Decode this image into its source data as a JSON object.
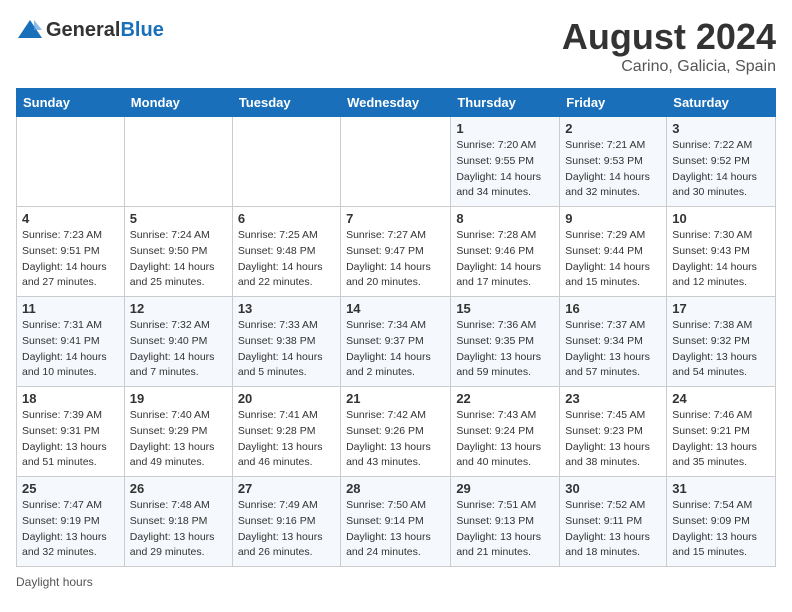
{
  "header": {
    "logo_general": "General",
    "logo_blue": "Blue",
    "month": "August 2024",
    "location": "Carino, Galicia, Spain"
  },
  "days_of_week": [
    "Sunday",
    "Monday",
    "Tuesday",
    "Wednesday",
    "Thursday",
    "Friday",
    "Saturday"
  ],
  "weeks": [
    [
      {
        "day": "",
        "info": ""
      },
      {
        "day": "",
        "info": ""
      },
      {
        "day": "",
        "info": ""
      },
      {
        "day": "",
        "info": ""
      },
      {
        "day": "1",
        "info": "Sunrise: 7:20 AM\nSunset: 9:55 PM\nDaylight: 14 hours\nand 34 minutes."
      },
      {
        "day": "2",
        "info": "Sunrise: 7:21 AM\nSunset: 9:53 PM\nDaylight: 14 hours\nand 32 minutes."
      },
      {
        "day": "3",
        "info": "Sunrise: 7:22 AM\nSunset: 9:52 PM\nDaylight: 14 hours\nand 30 minutes."
      }
    ],
    [
      {
        "day": "4",
        "info": "Sunrise: 7:23 AM\nSunset: 9:51 PM\nDaylight: 14 hours\nand 27 minutes."
      },
      {
        "day": "5",
        "info": "Sunrise: 7:24 AM\nSunset: 9:50 PM\nDaylight: 14 hours\nand 25 minutes."
      },
      {
        "day": "6",
        "info": "Sunrise: 7:25 AM\nSunset: 9:48 PM\nDaylight: 14 hours\nand 22 minutes."
      },
      {
        "day": "7",
        "info": "Sunrise: 7:27 AM\nSunset: 9:47 PM\nDaylight: 14 hours\nand 20 minutes."
      },
      {
        "day": "8",
        "info": "Sunrise: 7:28 AM\nSunset: 9:46 PM\nDaylight: 14 hours\nand 17 minutes."
      },
      {
        "day": "9",
        "info": "Sunrise: 7:29 AM\nSunset: 9:44 PM\nDaylight: 14 hours\nand 15 minutes."
      },
      {
        "day": "10",
        "info": "Sunrise: 7:30 AM\nSunset: 9:43 PM\nDaylight: 14 hours\nand 12 minutes."
      }
    ],
    [
      {
        "day": "11",
        "info": "Sunrise: 7:31 AM\nSunset: 9:41 PM\nDaylight: 14 hours\nand 10 minutes."
      },
      {
        "day": "12",
        "info": "Sunrise: 7:32 AM\nSunset: 9:40 PM\nDaylight: 14 hours\nand 7 minutes."
      },
      {
        "day": "13",
        "info": "Sunrise: 7:33 AM\nSunset: 9:38 PM\nDaylight: 14 hours\nand 5 minutes."
      },
      {
        "day": "14",
        "info": "Sunrise: 7:34 AM\nSunset: 9:37 PM\nDaylight: 14 hours\nand 2 minutes."
      },
      {
        "day": "15",
        "info": "Sunrise: 7:36 AM\nSunset: 9:35 PM\nDaylight: 13 hours\nand 59 minutes."
      },
      {
        "day": "16",
        "info": "Sunrise: 7:37 AM\nSunset: 9:34 PM\nDaylight: 13 hours\nand 57 minutes."
      },
      {
        "day": "17",
        "info": "Sunrise: 7:38 AM\nSunset: 9:32 PM\nDaylight: 13 hours\nand 54 minutes."
      }
    ],
    [
      {
        "day": "18",
        "info": "Sunrise: 7:39 AM\nSunset: 9:31 PM\nDaylight: 13 hours\nand 51 minutes."
      },
      {
        "day": "19",
        "info": "Sunrise: 7:40 AM\nSunset: 9:29 PM\nDaylight: 13 hours\nand 49 minutes."
      },
      {
        "day": "20",
        "info": "Sunrise: 7:41 AM\nSunset: 9:28 PM\nDaylight: 13 hours\nand 46 minutes."
      },
      {
        "day": "21",
        "info": "Sunrise: 7:42 AM\nSunset: 9:26 PM\nDaylight: 13 hours\nand 43 minutes."
      },
      {
        "day": "22",
        "info": "Sunrise: 7:43 AM\nSunset: 9:24 PM\nDaylight: 13 hours\nand 40 minutes."
      },
      {
        "day": "23",
        "info": "Sunrise: 7:45 AM\nSunset: 9:23 PM\nDaylight: 13 hours\nand 38 minutes."
      },
      {
        "day": "24",
        "info": "Sunrise: 7:46 AM\nSunset: 9:21 PM\nDaylight: 13 hours\nand 35 minutes."
      }
    ],
    [
      {
        "day": "25",
        "info": "Sunrise: 7:47 AM\nSunset: 9:19 PM\nDaylight: 13 hours\nand 32 minutes."
      },
      {
        "day": "26",
        "info": "Sunrise: 7:48 AM\nSunset: 9:18 PM\nDaylight: 13 hours\nand 29 minutes."
      },
      {
        "day": "27",
        "info": "Sunrise: 7:49 AM\nSunset: 9:16 PM\nDaylight: 13 hours\nand 26 minutes."
      },
      {
        "day": "28",
        "info": "Sunrise: 7:50 AM\nSunset: 9:14 PM\nDaylight: 13 hours\nand 24 minutes."
      },
      {
        "day": "29",
        "info": "Sunrise: 7:51 AM\nSunset: 9:13 PM\nDaylight: 13 hours\nand 21 minutes."
      },
      {
        "day": "30",
        "info": "Sunrise: 7:52 AM\nSunset: 9:11 PM\nDaylight: 13 hours\nand 18 minutes."
      },
      {
        "day": "31",
        "info": "Sunrise: 7:54 AM\nSunset: 9:09 PM\nDaylight: 13 hours\nand 15 minutes."
      }
    ]
  ],
  "footer": {
    "note": "Daylight hours"
  },
  "colors": {
    "header_bg": "#1a6fba",
    "header_text": "#ffffff",
    "accent": "#1a6fba"
  }
}
